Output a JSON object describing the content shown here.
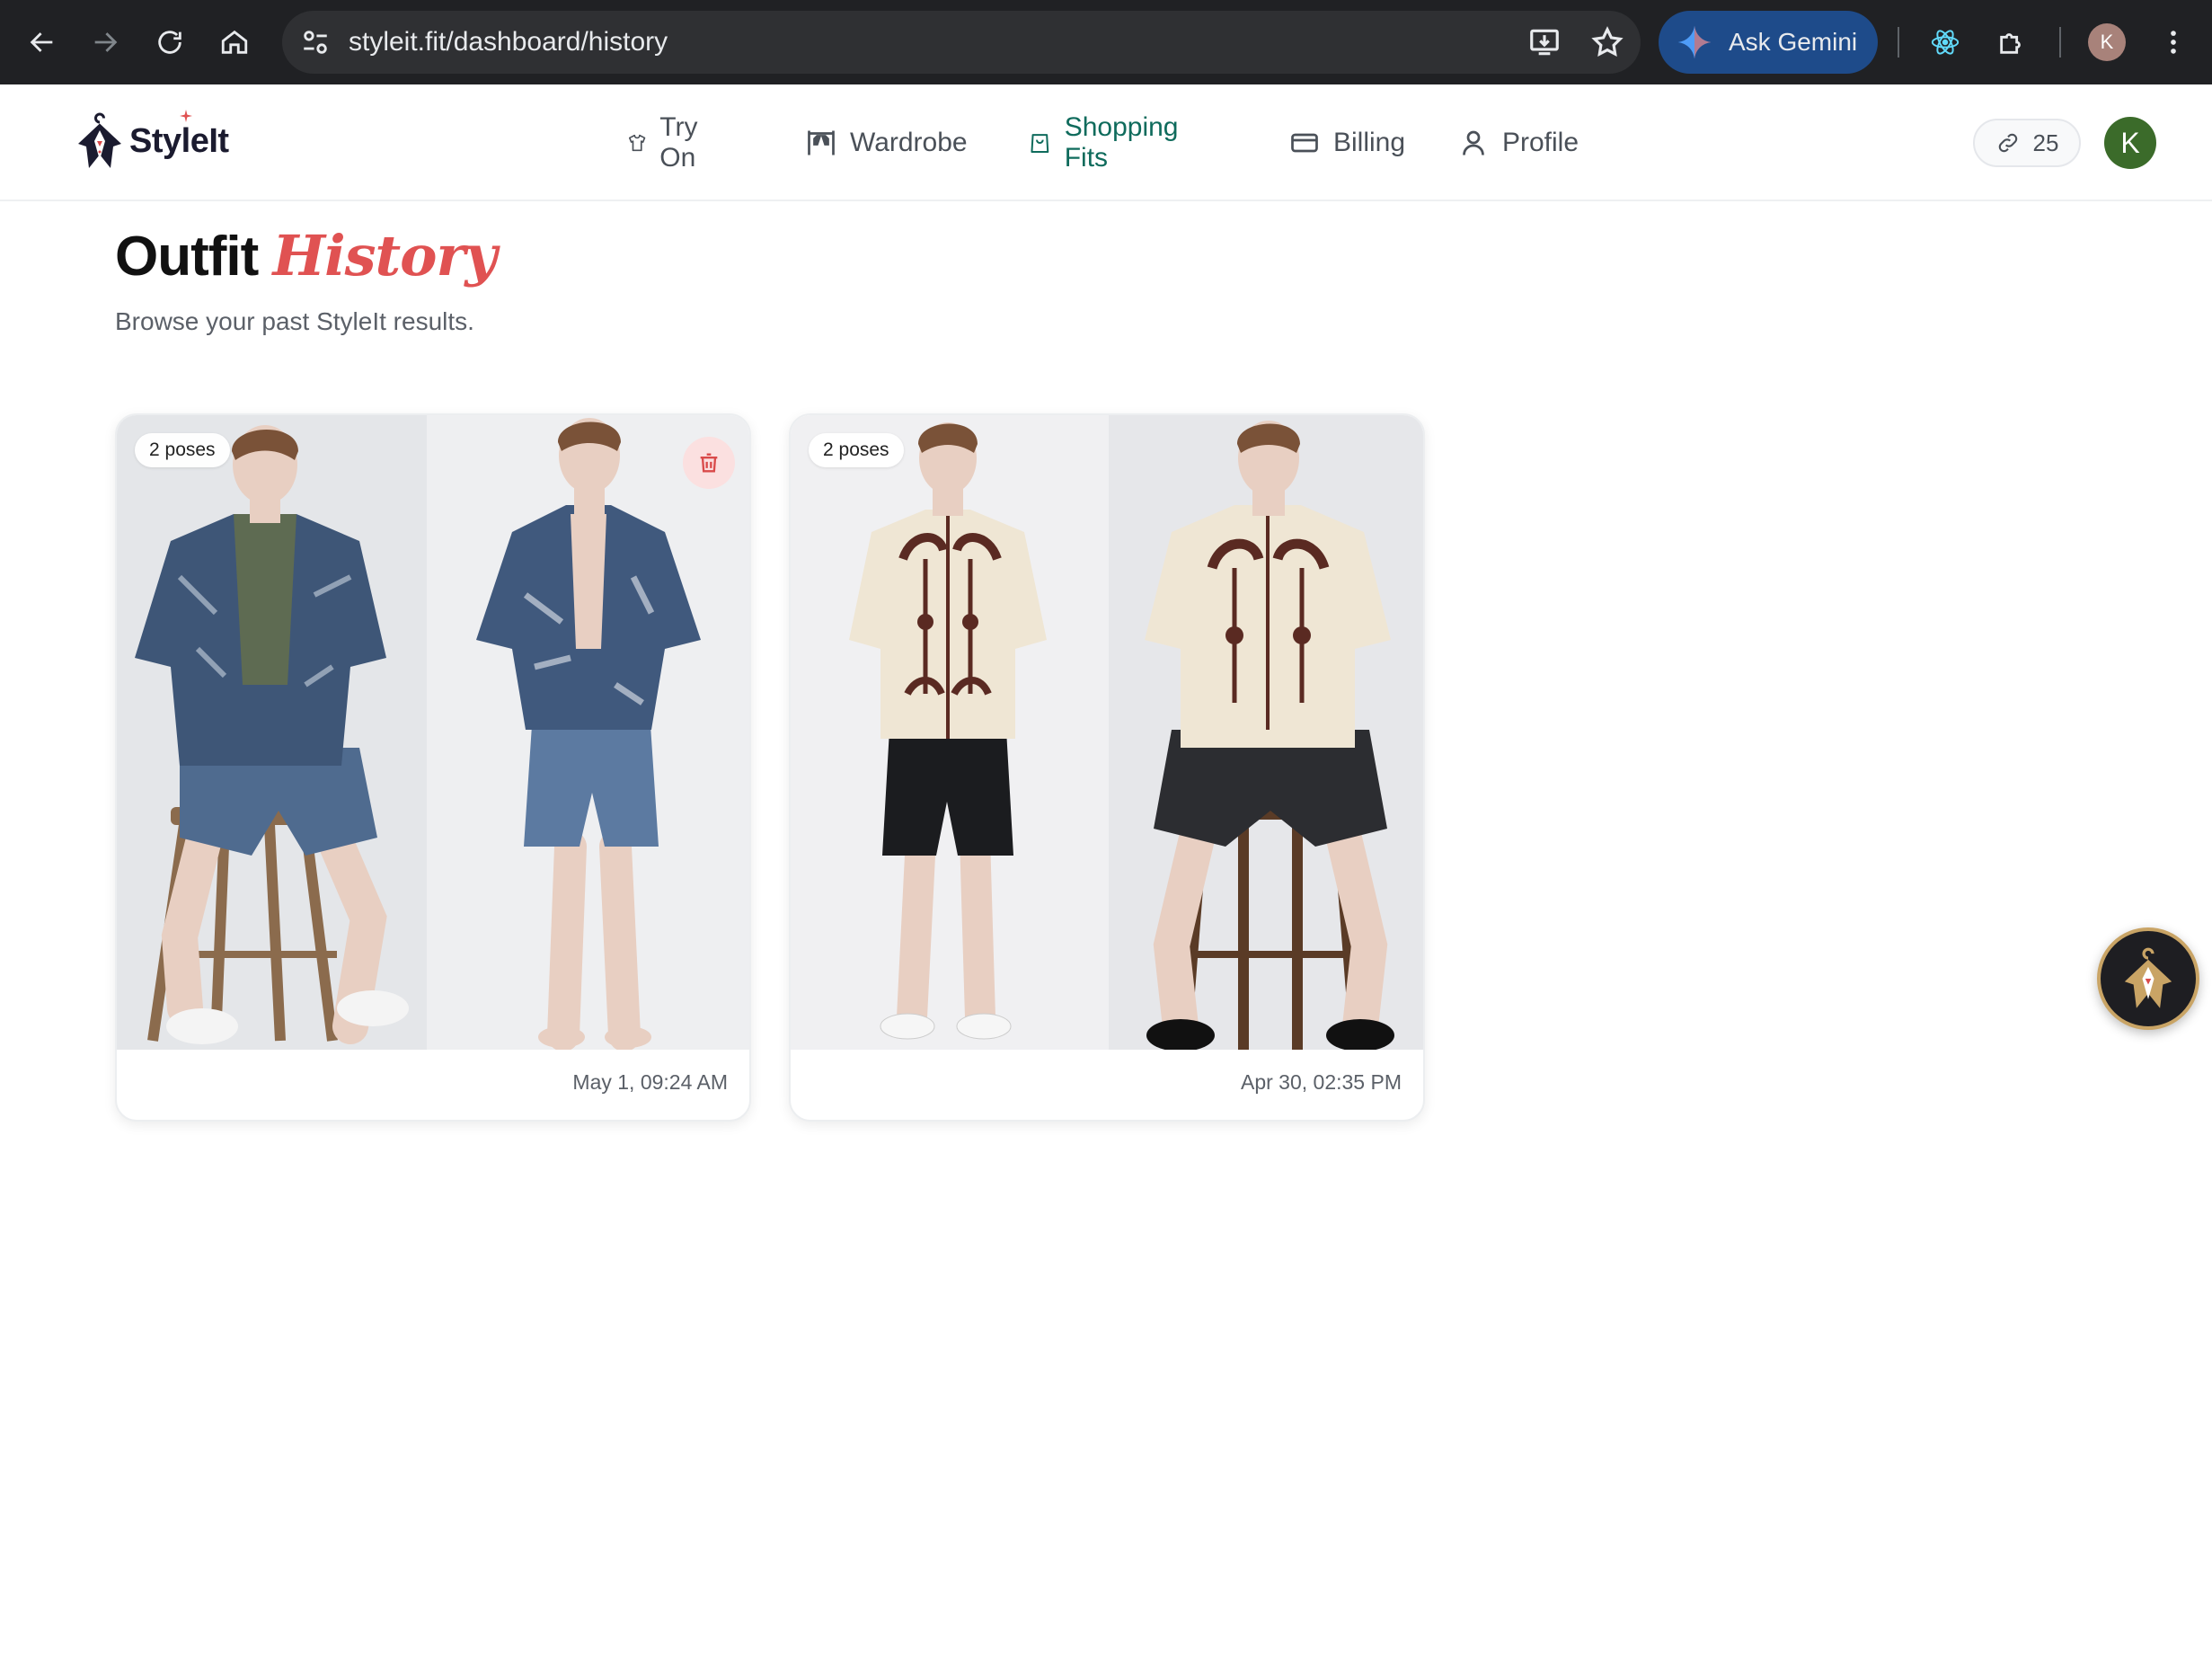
{
  "browser": {
    "url": "styleit.fit/dashboard/history",
    "gemini_label": "Ask Gemini",
    "profile_initial": "K"
  },
  "app": {
    "brand": "StyleIt",
    "nav": [
      {
        "label": "Try On",
        "icon": "shirt-icon",
        "active": false
      },
      {
        "label": "Wardrobe",
        "icon": "wardrobe-icon",
        "active": false
      },
      {
        "label": "Shopping Fits",
        "icon": "shopping-bag-icon",
        "active": true
      },
      {
        "label": "Billing",
        "icon": "credit-card-icon",
        "active": false
      },
      {
        "label": "Profile",
        "icon": "user-icon",
        "active": false
      }
    ],
    "credits": "25",
    "user_initial": "K"
  },
  "page": {
    "title_main": "Outfit",
    "title_accent": "History",
    "subtitle": "Browse your past StyleIt results."
  },
  "history": [
    {
      "poses_label": "2 poses",
      "date": "May 1, 09:24 AM",
      "has_delete": true
    },
    {
      "poses_label": "2 poses",
      "date": "Apr 30, 02:35 PM",
      "has_delete": false
    }
  ],
  "colors": {
    "accent_green": "#0f6b5c",
    "accent_red": "#e05252",
    "avatar_green": "#3b6b2a"
  }
}
